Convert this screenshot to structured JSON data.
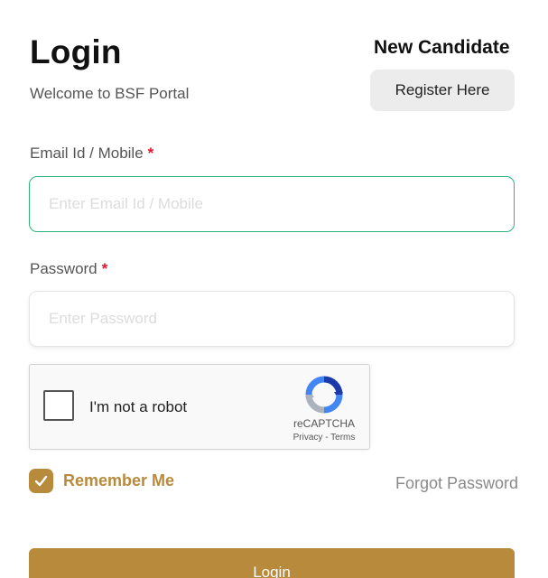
{
  "header": {
    "title": "Login",
    "subtitle": "Welcome to BSF Portal",
    "new_candidate_label": "New Candidate",
    "register_button": "Register Here"
  },
  "form": {
    "email": {
      "label": "Email Id / Mobile",
      "required_marker": "*",
      "placeholder": "Enter Email Id / Mobile",
      "value": ""
    },
    "password": {
      "label": "Password",
      "required_marker": "*",
      "placeholder": "Enter Password",
      "value": ""
    }
  },
  "recaptcha": {
    "checkbox_label": "I'm not a robot",
    "brand": "reCAPTCHA",
    "privacy_link": "Privacy",
    "separator": " - ",
    "terms_link": "Terms",
    "checked": false
  },
  "options": {
    "remember_label": "Remember Me",
    "remember_checked": true,
    "forgot_link": "Forgot Password"
  },
  "actions": {
    "login_button": "Login"
  },
  "colors": {
    "accent": "#b78a3c",
    "focus_border": "#2fb37e",
    "required": "#e0142c"
  },
  "icons": {
    "recaptcha": "recaptcha-logo-icon",
    "remember_check": "checkmark-icon"
  }
}
